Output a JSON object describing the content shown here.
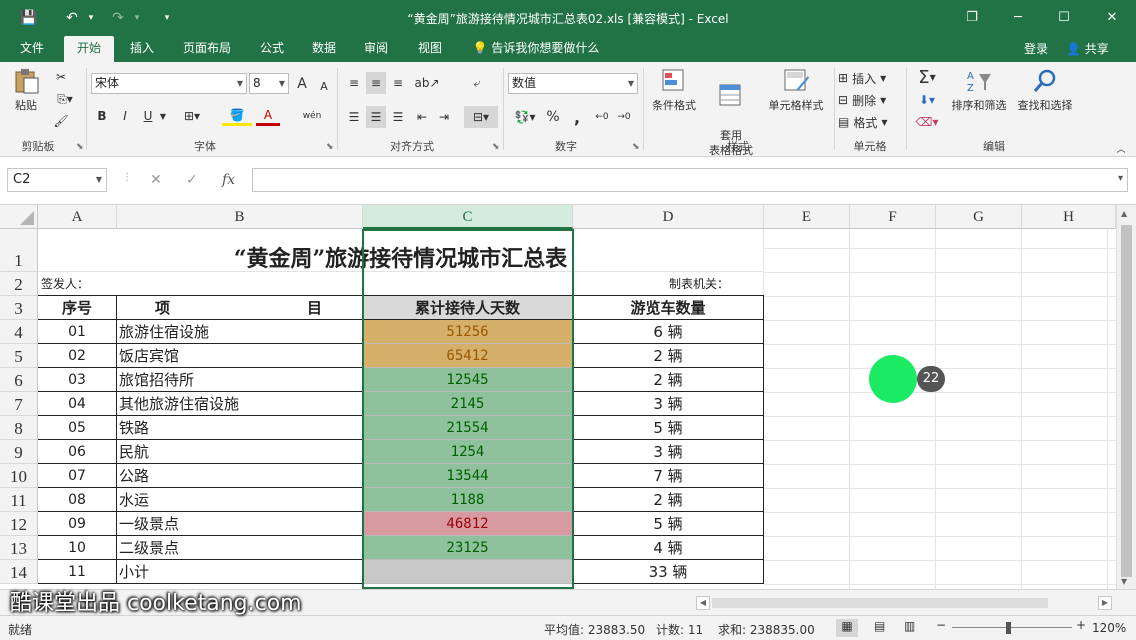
{
  "window": {
    "title": "“黄金周”旅游接待情况城市汇总表02.xls  [兼容模式] - Excel",
    "qa_save": "💾",
    "qa_undo": "↶",
    "qa_redo": "↷",
    "qa_more": "▾",
    "restore_icon": "❐",
    "min_icon": "─",
    "max_icon": "☐",
    "close_icon": "✕"
  },
  "tabs": [
    "文件",
    "开始",
    "插入",
    "页面布局",
    "公式",
    "数据",
    "审阅",
    "视图"
  ],
  "tell_me": "告诉我你想要做什么",
  "login": "登录",
  "share": "共享",
  "ribbon": {
    "paste": "粘贴",
    "clipboard": "剪贴板",
    "font_name": "宋体",
    "font_size": "8",
    "font_group": "字体",
    "bold": "B",
    "italic": "I",
    "underline": "U",
    "grow_font": "A",
    "shrink_font": "A",
    "font_color": "A",
    "wen": "wén",
    "align_group": "对齐方式",
    "number_format": "数值",
    "number_group": "数字",
    "percent": "%",
    "comma": ",",
    "cond_format": "条件格式",
    "table_format": "套用\n表格格式",
    "cell_style": "单元格样式",
    "style_group": "样式",
    "insert": "插入",
    "delete": "删除",
    "format": "格式",
    "cells_group": "单元格",
    "sort_filter": "排序和筛选",
    "find_select": "查找和选择",
    "edit_group": "编辑",
    "sigma": "Σ"
  },
  "formula_bar": {
    "name_box": "C2",
    "cancel": "✕",
    "confirm": "✓",
    "fx": "fx"
  },
  "columns": [
    "A",
    "B",
    "C",
    "D",
    "E",
    "F",
    "G",
    "H"
  ],
  "rows": [
    "1",
    "2",
    "3",
    "4",
    "5",
    "6",
    "7",
    "8",
    "9",
    "10",
    "11",
    "12",
    "13",
    "14"
  ],
  "sheet": {
    "title": "“黄金周”旅游接待情况城市汇总表",
    "sender": "签发人：",
    "maker": "制表机关：",
    "headers": [
      "序号",
      "项",
      "目",
      "累计接待人天数",
      "游览车数量"
    ],
    "data": [
      {
        "no": "01",
        "item": "旅游住宿设施",
        "value": "51256",
        "cars": "6 辆",
        "fill": "#d4b06a",
        "color": "#9c5700"
      },
      {
        "no": "02",
        "item": "饭店宾馆",
        "value": "65412",
        "cars": "2 辆",
        "fill": "#d4b06a",
        "color": "#9c5700"
      },
      {
        "no": "03",
        "item": "旅馆招待所",
        "value": "12545",
        "cars": "2 辆",
        "fill": "#8fc19c",
        "color": "#006100"
      },
      {
        "no": "04",
        "item": "其他旅游住宿设施",
        "value": "2145",
        "cars": "3 辆",
        "fill": "#8fc19c",
        "color": "#006100"
      },
      {
        "no": "05",
        "item": "铁路",
        "value": "21554",
        "cars": "5 辆",
        "fill": "#8fc19c",
        "color": "#006100"
      },
      {
        "no": "06",
        "item": "民航",
        "value": "1254",
        "cars": "3 辆",
        "fill": "#8fc19c",
        "color": "#006100"
      },
      {
        "no": "07",
        "item": "公路",
        "value": "13544",
        "cars": "7 辆",
        "fill": "#8fc19c",
        "color": "#006100"
      },
      {
        "no": "08",
        "item": "水运",
        "value": "1188",
        "cars": "2 辆",
        "fill": "#8fc19c",
        "color": "#006100"
      },
      {
        "no": "09",
        "item": "一级景点",
        "value": "46812",
        "cars": "5 辆",
        "fill": "#d79aa0",
        "color": "#9c0006"
      },
      {
        "no": "10",
        "item": "二级景点",
        "value": "23125",
        "cars": "4 辆",
        "fill": "#8fc19c",
        "color": "#006100"
      },
      {
        "no": "11",
        "item": "小计",
        "value": "",
        "cars": "33 辆",
        "fill": "#c8c8c8",
        "color": "#333333"
      }
    ]
  },
  "status": {
    "ready": "就绪",
    "average": "平均值: 23883.50",
    "count": "计数: 11",
    "sum": "求和: 238835.00",
    "zoom": "120%",
    "zoom_minus": "−",
    "zoom_plus": "+"
  },
  "overlay": {
    "badge": "22",
    "watermark": "酷课堂出品 coolketang.com"
  },
  "colors": {
    "accent": "#217346",
    "selected_col_header": "#d3ecdd"
  }
}
